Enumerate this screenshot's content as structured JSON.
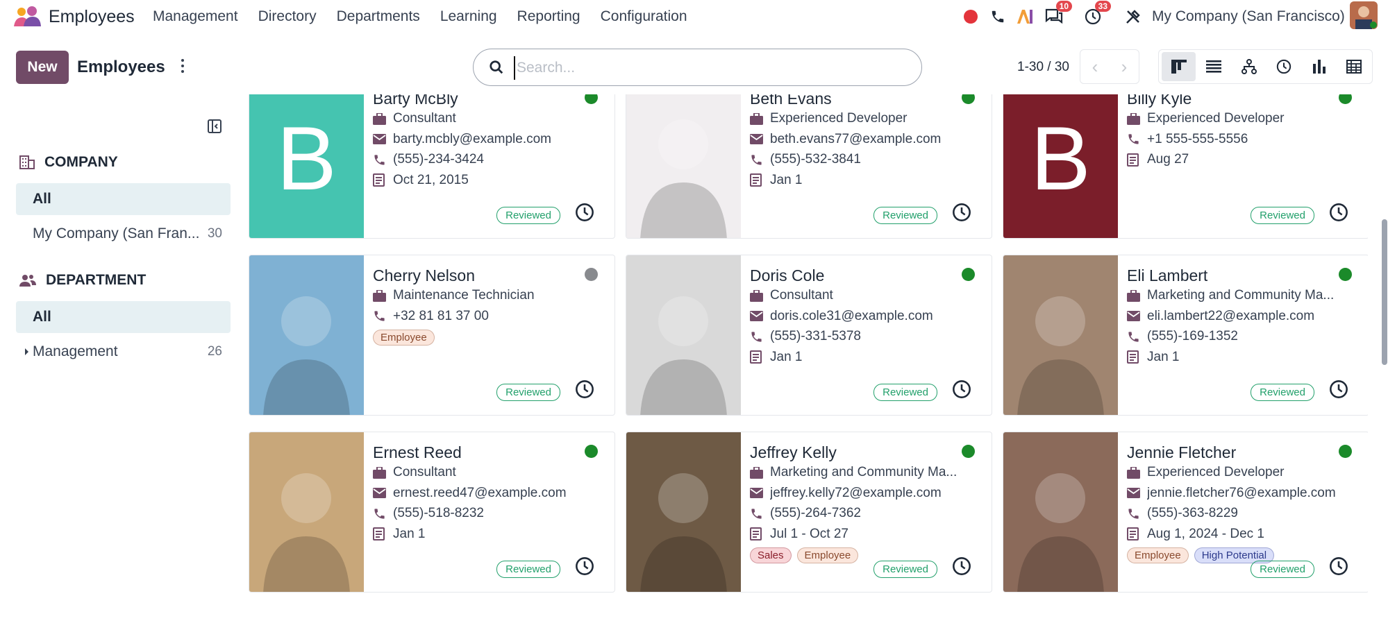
{
  "app": {
    "name": "Employees"
  },
  "menu": [
    "Management",
    "Directory",
    "Departments",
    "Learning",
    "Reporting",
    "Configuration"
  ],
  "systray": {
    "messages_count": "10",
    "activities_count": "33",
    "company": "My Company (San Francisco)"
  },
  "control_panel": {
    "new_label": "New",
    "title": "Employees",
    "search_placeholder": "Search...",
    "pager": "1-30 / 30",
    "views": [
      "kanban-icon",
      "list-icon",
      "hierarchy-icon",
      "activity-icon",
      "graph-icon",
      "pivot-icon"
    ]
  },
  "sidebar": {
    "company_header": "COMPANY",
    "company_items": [
      {
        "label": "All",
        "count": ""
      },
      {
        "label": "My Company (San Fran...",
        "count": "30"
      }
    ],
    "department_header": "DEPARTMENT",
    "department_items": [
      {
        "label": "All",
        "count": ""
      },
      {
        "label": "Management",
        "count": "26"
      }
    ]
  },
  "employees": [
    {
      "name": "Barty McBly",
      "initial": "B",
      "photo_color": "#45c4b0",
      "status": "online",
      "lines": [
        [
          "briefcase-icon",
          "Consultant"
        ],
        [
          "envelope-icon",
          "barty.mcbly@example.com"
        ],
        [
          "phone-icon",
          "(555)-234-3424"
        ],
        [
          "contract-icon",
          "Oct 21, 2015"
        ]
      ],
      "tags": [],
      "badge": "Reviewed"
    },
    {
      "name": "Beth Evans",
      "initial": "",
      "photo_color": "#f1eef0",
      "status": "online",
      "lines": [
        [
          "briefcase-icon",
          "Experienced Developer"
        ],
        [
          "envelope-icon",
          "beth.evans77@example.com"
        ],
        [
          "phone-icon",
          "(555)-532-3841"
        ],
        [
          "contract-icon",
          "Jan 1"
        ]
      ],
      "tags": [],
      "badge": "Reviewed"
    },
    {
      "name": "Billy Kyle",
      "initial": "B",
      "photo_color": "#7b1e2a",
      "status": "online",
      "lines": [
        [
          "briefcase-icon",
          "Experienced Developer"
        ],
        [
          "phone-icon",
          "+1 555-555-5556"
        ],
        [
          "contract-icon",
          "Aug 27"
        ]
      ],
      "tags": [],
      "badge": "Reviewed"
    },
    {
      "name": "Cherry Nelson",
      "initial": "",
      "photo_color": "#7fb1d3",
      "status": "offline",
      "lines": [
        [
          "briefcase-icon",
          "Maintenance Technician"
        ],
        [
          "phone-icon",
          "+32 81 81 37 00"
        ]
      ],
      "tags": [
        [
          "Employee",
          "#fbe6dc",
          "#8a4a2e"
        ]
      ],
      "badge": "Reviewed"
    },
    {
      "name": "Doris Cole",
      "initial": "",
      "photo_color": "#d9d9d9",
      "status": "online",
      "lines": [
        [
          "briefcase-icon",
          "Consultant"
        ],
        [
          "envelope-icon",
          "doris.cole31@example.com"
        ],
        [
          "phone-icon",
          "(555)-331-5378"
        ],
        [
          "contract-icon",
          "Jan 1"
        ]
      ],
      "tags": [],
      "badge": "Reviewed"
    },
    {
      "name": "Eli Lambert",
      "initial": "",
      "photo_color": "#a08570",
      "status": "online",
      "lines": [
        [
          "briefcase-icon",
          "Marketing and Community Ma..."
        ],
        [
          "envelope-icon",
          "eli.lambert22@example.com"
        ],
        [
          "phone-icon",
          "(555)-169-1352"
        ],
        [
          "contract-icon",
          "Jan 1"
        ]
      ],
      "tags": [],
      "badge": "Reviewed"
    },
    {
      "name": "Ernest Reed",
      "initial": "",
      "photo_color": "#c8a77a",
      "status": "online",
      "lines": [
        [
          "briefcase-icon",
          "Consultant"
        ],
        [
          "envelope-icon",
          "ernest.reed47@example.com"
        ],
        [
          "phone-icon",
          "(555)-518-8232"
        ],
        [
          "contract-icon",
          "Jan 1"
        ]
      ],
      "tags": [],
      "badge": "Reviewed"
    },
    {
      "name": "Jeffrey Kelly",
      "initial": "",
      "photo_color": "#6e5a45",
      "status": "online",
      "lines": [
        [
          "briefcase-icon",
          "Marketing and Community Ma..."
        ],
        [
          "envelope-icon",
          "jeffrey.kelly72@example.com"
        ],
        [
          "phone-icon",
          "(555)-264-7362"
        ],
        [
          "contract-icon",
          "Jul 1 - Oct 27"
        ]
      ],
      "tags": [
        [
          "Sales",
          "#f8d5d8",
          "#8a1f2b"
        ],
        [
          "Employee",
          "#fbe6dc",
          "#8a4a2e"
        ]
      ],
      "badge": "Reviewed"
    },
    {
      "name": "Jennie Fletcher",
      "initial": "",
      "photo_color": "#8b6a5a",
      "status": "online",
      "lines": [
        [
          "briefcase-icon",
          "Experienced Developer"
        ],
        [
          "envelope-icon",
          "jennie.fletcher76@example.com"
        ],
        [
          "phone-icon",
          "(555)-363-8229"
        ],
        [
          "contract-icon",
          "Aug 1, 2024 - Dec 1"
        ]
      ],
      "tags": [
        [
          "Employee",
          "#fbe6dc",
          "#8a4a2e"
        ],
        [
          "High Potential",
          "#d9def9",
          "#2d3a8c"
        ]
      ],
      "badge": "Reviewed"
    }
  ],
  "colors": {
    "primary": "#714b67",
    "online": "#1b8a2a",
    "offline": "#888a8e",
    "reviewed": "#22a06b"
  }
}
